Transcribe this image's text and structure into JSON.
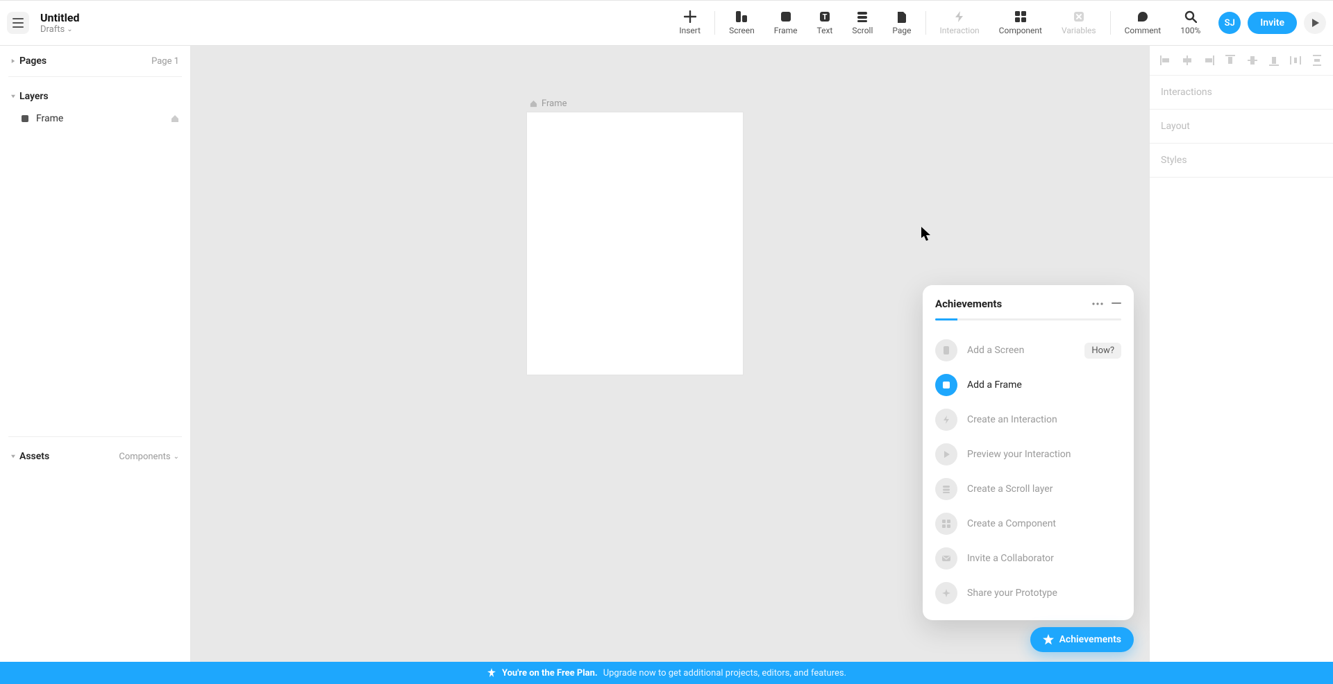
{
  "doc": {
    "title": "Untitled",
    "folder": "Drafts"
  },
  "toolbar": {
    "insert": "Insert",
    "screen": "Screen",
    "frame": "Frame",
    "text": "Text",
    "scroll": "Scroll",
    "page": "Page",
    "interaction": "Interaction",
    "component": "Component",
    "variables": "Variables",
    "comment": "Comment",
    "zoom": "100%",
    "avatar": "SJ",
    "invite": "Invite"
  },
  "left": {
    "pages_label": "Pages",
    "pages_aside": "Page 1",
    "layers_label": "Layers",
    "layer0_name": "Frame",
    "assets_label": "Assets",
    "assets_aside": "Components"
  },
  "canvas": {
    "frame_label": "Frame"
  },
  "achievements": {
    "title": "Achievements",
    "progress_percent": 12,
    "items": {
      "0": {
        "label": "Add a Screen",
        "how": "How?"
      },
      "1": {
        "label": "Add a Frame"
      },
      "2": {
        "label": "Create an Interaction"
      },
      "3": {
        "label": "Preview your Interaction"
      },
      "4": {
        "label": "Create a Scroll layer"
      },
      "5": {
        "label": "Create a Component"
      },
      "6": {
        "label": "Invite a Collaborator"
      },
      "7": {
        "label": "Share your Prototype"
      }
    },
    "pill": "Achievements"
  },
  "right": {
    "interactions": "Interactions",
    "layout": "Layout",
    "styles": "Styles"
  },
  "banner": {
    "bold": "You're on the Free Plan.",
    "rest": "Upgrade now to get additional projects, editors, and features."
  }
}
